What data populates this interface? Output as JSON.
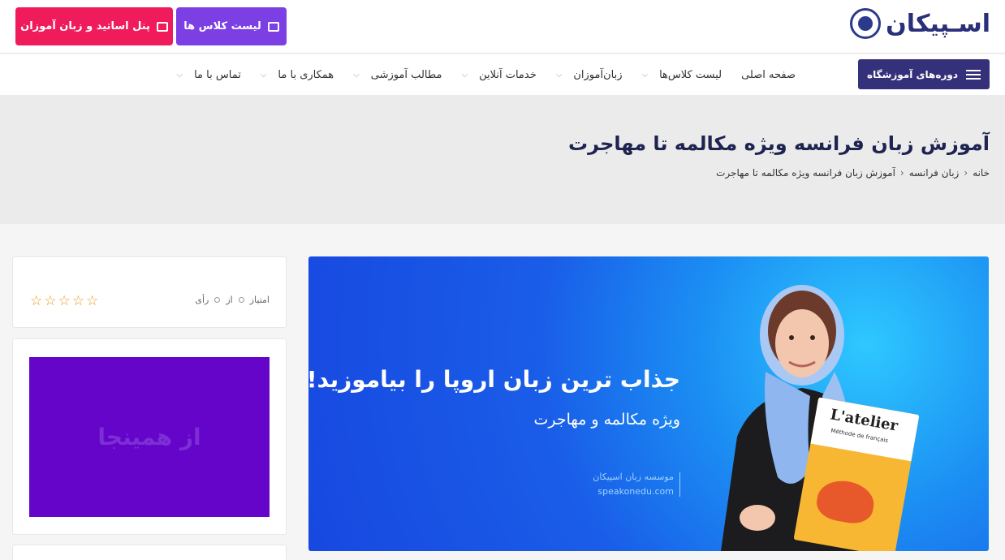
{
  "header": {
    "logo_text": "اسـپیکان",
    "panel_button": "پنل اساتید و زبان آموزان",
    "classes_button": "لیست کلاس ها"
  },
  "nav": {
    "dept_button": "دوره‌های آموزشگاه",
    "items": [
      {
        "label": "صفحه اصلی",
        "has_dropdown": false
      },
      {
        "label": "لیست کلاس‌ها",
        "has_dropdown": true
      },
      {
        "label": "زبان‌آموزان",
        "has_dropdown": true
      },
      {
        "label": "خدمات آنلاین",
        "has_dropdown": true
      },
      {
        "label": "مطالب آموزشی",
        "has_dropdown": true
      },
      {
        "label": "همکاری با ما",
        "has_dropdown": true
      },
      {
        "label": "تماس با ما",
        "has_dropdown": true
      }
    ]
  },
  "page": {
    "title": "آموزش زبان فرانسه ویژه مکالمه تا مهاجرت",
    "breadcrumb": [
      "خانه",
      "زبان فرانسه",
      "آموزش زبان فرانسه ویژه مکالمه تا مهاجرت"
    ]
  },
  "banner": {
    "headline": "جذاب ترین زبان اروپا را بیاموزید!",
    "subline": "ویژه مکالمه و مهاجرت",
    "institute": "موسسه زبان اسپیکان",
    "url": "speakonedu.com",
    "book_title": "L'atelier",
    "book_subtitle": "Méthode de français"
  },
  "rating": {
    "label_score": "امتیاز",
    "score": "0",
    "label_of": "از",
    "votes": "0",
    "label_votes": "رأی",
    "stars": 0,
    "max_stars": 5
  },
  "ad": {
    "text": "از همینجا"
  },
  "colors": {
    "brand_navy": "#35307a",
    "panel_pink": "#ef1b5a",
    "classes_purple": "#7b3fe4",
    "ad_purple": "#6505c9",
    "star_orange": "#e89a1f"
  }
}
